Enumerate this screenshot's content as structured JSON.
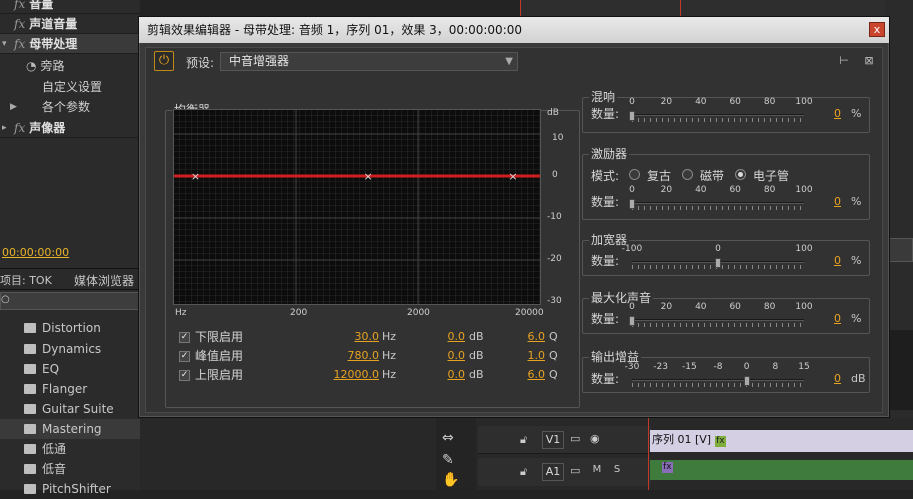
{
  "left_panel": {
    "effects": [
      {
        "fx": "fx",
        "label": "音量"
      },
      {
        "fx": "fx",
        "label": "声道音量"
      },
      {
        "fx": "fx",
        "label": "母带处理"
      }
    ],
    "sub_items": [
      "旁路",
      "自定义设置",
      "各个参数"
    ],
    "effect_last": {
      "fx": "fx",
      "label": "声像器"
    },
    "timecode": "00:00:00:00",
    "tab_project": "项目: TOK",
    "tab_media": "媒体浏览器",
    "presets": [
      "Distortion",
      "Dynamics",
      "EQ",
      "Flanger",
      "Guitar Suite",
      "Mastering",
      "低通",
      "低音",
      "PitchShifter"
    ]
  },
  "dialog": {
    "title": "剪辑效果编辑器 - 母带处理: 音频 1，序列 01，效果 3，00:00:00:00",
    "close": "x",
    "power_icon": "power-icon",
    "preset_label": "预设:",
    "preset_value": "中音增强器",
    "eq": {
      "title": "均衡器",
      "db_label": "dB",
      "db_ticks": [
        "10",
        "0",
        "-10",
        "-20",
        "-30"
      ],
      "hz_label": "Hz",
      "hz_ticks": [
        "200",
        "2000",
        "20000"
      ],
      "curve_gain_db": 0,
      "bands": [
        {
          "label": "下限启用",
          "checked": true,
          "freq": "30.0",
          "freq_unit": "Hz",
          "gain": "0.0",
          "gain_unit": "dB",
          "q": "6.0",
          "q_unit": "Q"
        },
        {
          "label": "峰值启用",
          "checked": true,
          "freq": "780.0",
          "freq_unit": "Hz",
          "gain": "0.0",
          "gain_unit": "dB",
          "q": "1.0",
          "q_unit": "Q"
        },
        {
          "label": "上限启用",
          "checked": true,
          "freq": "12000.0",
          "freq_unit": "Hz",
          "gain": "0.0",
          "gain_unit": "dB",
          "q": "6.0",
          "q_unit": "Q"
        }
      ]
    },
    "reverb": {
      "title": "混响",
      "amount_label": "数量:",
      "scale": [
        "0",
        "20",
        "40",
        "60",
        "80",
        "100"
      ],
      "value": "0",
      "unit": "%",
      "level": 0
    },
    "exciter": {
      "title": "激励器",
      "mode_label": "模式:",
      "modes": [
        "复古",
        "磁带",
        "电子管"
      ],
      "selected_mode": "电子管",
      "amount_label": "数量:",
      "scale": [
        "0",
        "20",
        "40",
        "60",
        "80",
        "100"
      ],
      "value": "0",
      "unit": "%",
      "level": 0
    },
    "widener": {
      "title": "加宽器",
      "amount_label": "数量:",
      "scale": [
        "-100",
        "0",
        "100"
      ],
      "value": "0",
      "unit": "%",
      "level": 0.5
    },
    "loudness": {
      "title": "最大化声音",
      "amount_label": "数量:",
      "scale": [
        "0",
        "20",
        "40",
        "60",
        "80",
        "100"
      ],
      "value": "0",
      "unit": "%",
      "level": 0
    },
    "output_gain": {
      "title": "输出增益",
      "amount_label": "数量:",
      "scale": [
        "-30",
        "-23",
        "-15",
        "-8",
        "0",
        "8",
        "15"
      ],
      "value": "0",
      "unit": "dB",
      "level": 0.667
    }
  },
  "timeline": {
    "v1": "V1",
    "a1": "A1",
    "m": "M",
    "s": "S",
    "clip_label": "序列 01 [V]",
    "fx_badge": "fx"
  },
  "colors": {
    "accent": "#e6a221",
    "eq_curve": "#d11f1f",
    "audio_clip": "#3e7b3c",
    "video_clip": "#c9c2dc"
  }
}
